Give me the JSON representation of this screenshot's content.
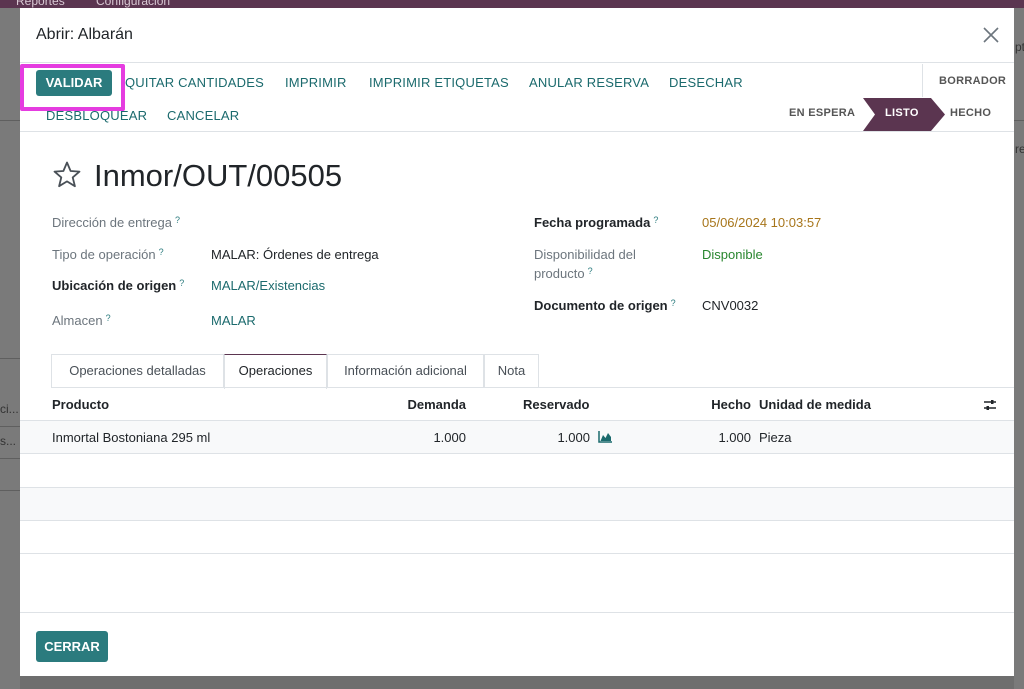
{
  "background": {
    "menu": [
      "Reportes",
      "Configuración"
    ],
    "left_fragments": [
      "ci...",
      "s..."
    ],
    "right_fragments": [
      "pt",
      "re"
    ]
  },
  "modal": {
    "title": "Abrir: Albarán"
  },
  "statusbar": {
    "buttons": [
      "VALIDAR",
      "QUITAR CANTIDADES",
      "IMPRIMIR",
      "IMPRIMIR ETIQUETAS",
      "ANULAR RESERVA",
      "DESECHAR",
      "DESBLOQUEAR",
      "CANCELAR"
    ],
    "stages": [
      "BORRADOR",
      "EN ESPERA",
      "LISTO",
      "HECHO"
    ],
    "active_stage": "LISTO",
    "accent_color": "#2b7b7e",
    "active_stage_color": "#5b3550",
    "highlight_color": "#e53ce0"
  },
  "record": {
    "name": "Inmor/OUT/00505"
  },
  "fields": {
    "direccion_entrega_label": "Dirección de entrega",
    "tipo_operacion_label": "Tipo de operación",
    "tipo_operacion_value": "MALAR: Órdenes de entrega",
    "ubicacion_origen_label": "Ubicación de origen",
    "ubicacion_origen_value": "MALAR/Existencias",
    "almacen_label": "Almacen",
    "almacen_value": "MALAR",
    "fecha_label": "Fecha programada",
    "fecha_value": "05/06/2024 10:03:57",
    "disponibilidad_label_1": "Disponibilidad del",
    "disponibilidad_label_2": "producto",
    "disponibilidad_value": "Disponible",
    "documento_label": "Documento de origen",
    "documento_value": "CNV0032",
    "help_mark": "?"
  },
  "tabs": [
    "Operaciones detalladas",
    "Operaciones",
    "Información adicional",
    "Nota"
  ],
  "active_tab": "Operaciones",
  "table": {
    "headers": [
      "Producto",
      "Demanda",
      "Reservado",
      "Hecho",
      "Unidad de medida"
    ],
    "rows": [
      {
        "producto": "Inmortal Bostoniana 295 ml",
        "demanda": "1.000",
        "reservado": "1.000",
        "hecho": "1.000",
        "unidad": "Pieza"
      }
    ]
  },
  "footer": {
    "close_label": "CERRAR"
  }
}
